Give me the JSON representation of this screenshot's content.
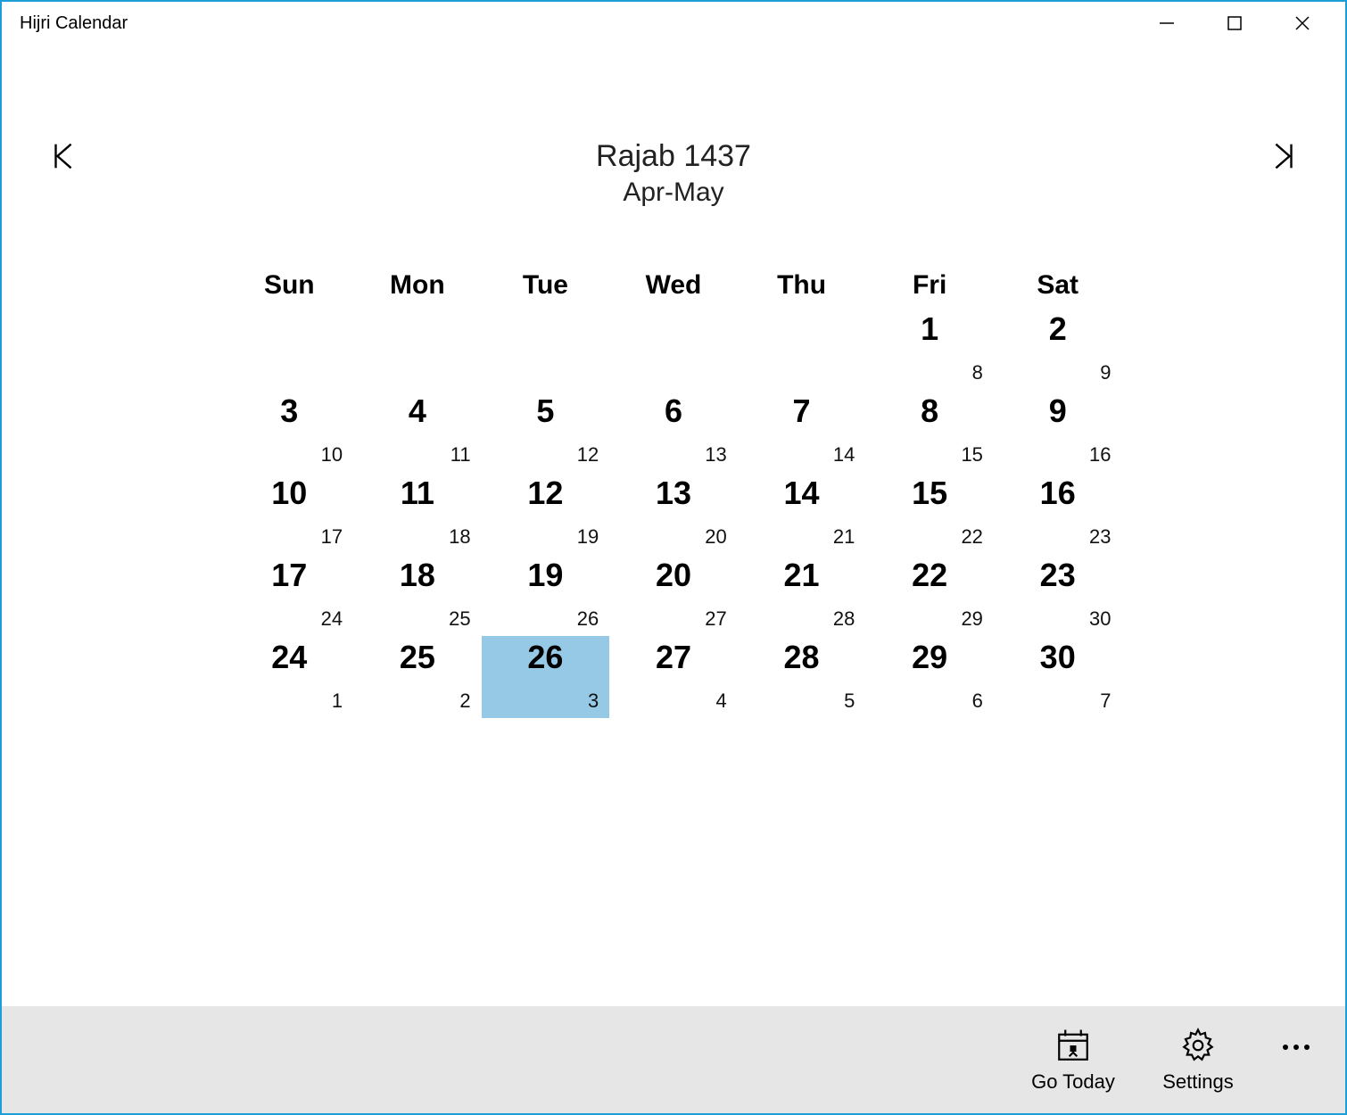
{
  "window": {
    "title": "Hijri Calendar"
  },
  "header": {
    "hijri": "Rajab 1437",
    "gregorian": "Apr-May"
  },
  "weekdays": [
    "Sun",
    "Mon",
    "Tue",
    "Wed",
    "Thu",
    "Fri",
    "Sat"
  ],
  "cells": [
    {
      "empty": true
    },
    {
      "empty": true
    },
    {
      "empty": true
    },
    {
      "empty": true
    },
    {
      "empty": true
    },
    {
      "h": "1",
      "g": "8"
    },
    {
      "h": "2",
      "g": "9"
    },
    {
      "h": "3",
      "g": "10"
    },
    {
      "h": "4",
      "g": "11"
    },
    {
      "h": "5",
      "g": "12"
    },
    {
      "h": "6",
      "g": "13"
    },
    {
      "h": "7",
      "g": "14"
    },
    {
      "h": "8",
      "g": "15"
    },
    {
      "h": "9",
      "g": "16"
    },
    {
      "h": "10",
      "g": "17"
    },
    {
      "h": "11",
      "g": "18"
    },
    {
      "h": "12",
      "g": "19"
    },
    {
      "h": "13",
      "g": "20"
    },
    {
      "h": "14",
      "g": "21"
    },
    {
      "h": "15",
      "g": "22"
    },
    {
      "h": "16",
      "g": "23"
    },
    {
      "h": "17",
      "g": "24"
    },
    {
      "h": "18",
      "g": "25"
    },
    {
      "h": "19",
      "g": "26"
    },
    {
      "h": "20",
      "g": "27"
    },
    {
      "h": "21",
      "g": "28"
    },
    {
      "h": "22",
      "g": "29"
    },
    {
      "h": "23",
      "g": "30"
    },
    {
      "h": "24",
      "g": "1"
    },
    {
      "h": "25",
      "g": "2"
    },
    {
      "h": "26",
      "g": "3",
      "selected": true
    },
    {
      "h": "27",
      "g": "4"
    },
    {
      "h": "28",
      "g": "5"
    },
    {
      "h": "29",
      "g": "6"
    },
    {
      "h": "30",
      "g": "7"
    }
  ],
  "toolbar": {
    "go_today": "Go Today",
    "settings": "Settings"
  }
}
